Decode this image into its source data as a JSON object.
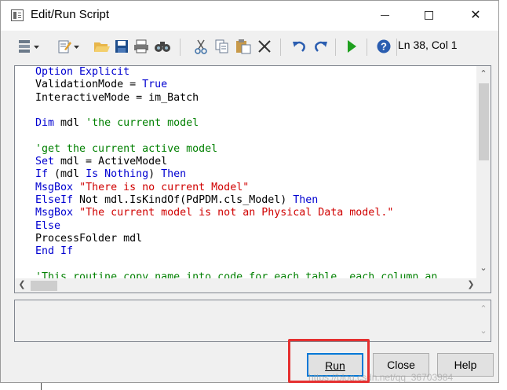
{
  "window": {
    "title": "Edit/Run Script",
    "minimize_label": "",
    "maximize_label": "",
    "close_label": "✕"
  },
  "toolbar": {
    "status": "Ln 38, Col 1",
    "icons": [
      "properties-dropdown-icon",
      "edit-dropdown-icon",
      "open-folder-icon",
      "save-icon",
      "print-icon",
      "find-icon",
      "cut-icon",
      "copy-icon",
      "paste-icon",
      "delete-icon",
      "undo-icon",
      "redo-icon",
      "run-icon",
      "help-icon"
    ]
  },
  "editor": {
    "lines": [
      [
        {
          "t": "Option Explicit",
          "c": "kw"
        }
      ],
      [
        {
          "t": "ValidationMode = ",
          "c": "tx"
        },
        {
          "t": "True",
          "c": "kw"
        }
      ],
      [
        {
          "t": "InteractiveMode = im_Batch",
          "c": "tx"
        }
      ],
      [],
      [
        {
          "t": "Dim",
          "c": "kw"
        },
        {
          "t": " mdl ",
          "c": "tx"
        },
        {
          "t": "'the current model",
          "c": "cm"
        }
      ],
      [],
      [
        {
          "t": "'get the current active model",
          "c": "cm"
        }
      ],
      [
        {
          "t": "Set",
          "c": "kw"
        },
        {
          "t": " mdl = ActiveModel",
          "c": "tx"
        }
      ],
      [
        {
          "t": "If",
          "c": "kw"
        },
        {
          "t": " (mdl ",
          "c": "tx"
        },
        {
          "t": "Is",
          "c": "kw"
        },
        {
          "t": " ",
          "c": "tx"
        },
        {
          "t": "Nothing",
          "c": "kw"
        },
        {
          "t": ") ",
          "c": "tx"
        },
        {
          "t": "Then",
          "c": "kw"
        }
      ],
      [
        {
          "t": "MsgBox",
          "c": "kw"
        },
        {
          "t": " ",
          "c": "tx"
        },
        {
          "t": "\"There is no current Model\"",
          "c": "st"
        }
      ],
      [
        {
          "t": "ElseIf",
          "c": "kw"
        },
        {
          "t": " Not mdl.IsKindOf(PdPDM.cls_Model) ",
          "c": "tx"
        },
        {
          "t": "Then",
          "c": "kw"
        }
      ],
      [
        {
          "t": "MsgBox",
          "c": "kw"
        },
        {
          "t": " ",
          "c": "tx"
        },
        {
          "t": "\"The current model is not an Physical Data model.\"",
          "c": "st"
        }
      ],
      [
        {
          "t": "Else",
          "c": "kw"
        }
      ],
      [
        {
          "t": "ProcessFolder mdl",
          "c": "tx"
        }
      ],
      [
        {
          "t": "End If",
          "c": "kw"
        }
      ],
      [],
      [
        {
          "t": "'This routine copy name into code for each table, each column an",
          "c": "cm"
        }
      ]
    ]
  },
  "buttons": {
    "run": "Run",
    "close": "Close",
    "help": "Help"
  },
  "watermark": "https://blog.csdn.net/qq_36703984"
}
